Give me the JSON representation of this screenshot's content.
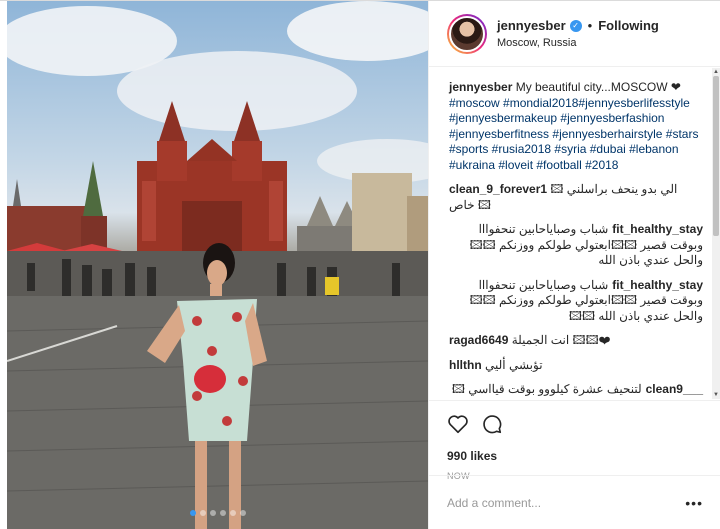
{
  "post": {
    "username": "jennyesber",
    "verified_icon": "verified-badge-icon",
    "separator": "•",
    "follow_state": "Following",
    "location": "Moscow, Russia",
    "caption": {
      "user": "jennyesber",
      "text": "My beautiful city...MOSCOW ❤",
      "hashtags": "#moscow #mondial2018#jennyesberlifesstyle #jennyesbermakeup #jennyesberfashion #jennyesberfitness #jennyesberhairstyle #stars #sports #rusia2018 #syria #dubai #lebanon #ukraina #loveit #football #2018"
    },
    "comments": [
      {
        "user": "clean_9_forever1",
        "text": "الي بدو ينحف براسلني 🖾 خاص 🖾",
        "rtl": false
      },
      {
        "user": "fit_healthy_stay",
        "text": "شباب وصباياحابين تنحفوااا وبوقت قصير 🖾🖾ابعتولي طولكم ووزنكم 🖾🖾 والحل عندي باذن الله",
        "rtl": true
      },
      {
        "user": "fit_healthy_stay",
        "text": "شباب وصباياحابين تنحفوااا وبوقت قصير 🖾🖾ابعتولي طولكم ووزنكم 🖾🖾 والحل عندي باذن الله 🖾🖾",
        "rtl": true
      },
      {
        "user": "ragad6649",
        "text": "انت الجميلة 🖾🖾❤",
        "rtl": false
      },
      {
        "user": "hllthn",
        "text": "تؤبشي أليي",
        "rtl": false
      },
      {
        "user": "___clean9",
        "text": "لتنحيف عشرة كيلووو بوقت قيااسي 🖾🖾🖾 جداا راسلوني",
        "rtl": true
      }
    ],
    "likes": "990 likes",
    "time": "NOW",
    "add_comment_placeholder": "Add a comment...",
    "more_icon": "•••",
    "carousel_dots": 6
  }
}
